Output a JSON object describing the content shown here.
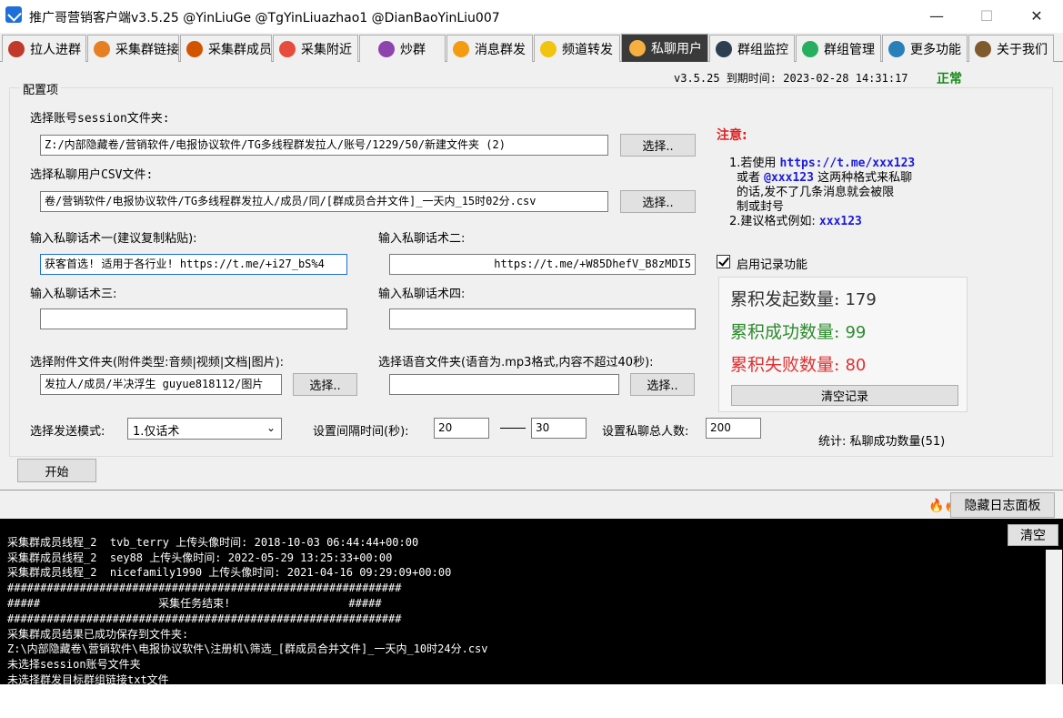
{
  "window": {
    "title": "推广哥营销客户端v3.5.25 @YinLiuGe @TgYinLiuazhao1 @DianBaoYinLiu007",
    "minimize": "—",
    "maximize": "☐",
    "close": "✕"
  },
  "tabs": [
    {
      "label": "拉人进群",
      "icon_color": "#c0392b"
    },
    {
      "label": "采集群链接",
      "icon_color": "#e67e22"
    },
    {
      "label": "采集群成员",
      "icon_color": "#d35400"
    },
    {
      "label": "采集附近",
      "icon_color": "#e74c3c"
    },
    {
      "label": "炒群",
      "icon_color": "#8e44ad"
    },
    {
      "label": "消息群发",
      "icon_color": "#f39c12"
    },
    {
      "label": "频道转发",
      "icon_color": "#f1c40f"
    },
    {
      "label": "私聊用户",
      "icon_color": "#f5b041"
    },
    {
      "label": "群组监控",
      "icon_color": "#2c3e50"
    },
    {
      "label": "群组管理",
      "icon_color": "#27ae60"
    },
    {
      "label": "更多功能",
      "icon_color": "#2980b9"
    },
    {
      "label": "关于我们",
      "icon_color": "#7f5a2c"
    }
  ],
  "active_tab": "私聊用户",
  "status": {
    "version_expiry": "v3.5.25 到期时间: 2023-02-28 14:31:17",
    "state": "正常"
  },
  "config": {
    "legend": "配置项",
    "session_label": "选择账号session文件夹:",
    "session_value": "Z:/内部隐藏卷/营销软件/电报协议软件/TG多线程群发拉人/账号/1229/50/新建文件夹 (2)",
    "choose_btn": "选择..",
    "csv_label": "选择私聊用户CSV文件:",
    "csv_value": "卷/营销软件/电报协议软件/TG多线程群发拉人/成员/同/[群成员合并文件]_一天内_15时02分.csv",
    "script1_label": "输入私聊话术一(建议复制粘贴):",
    "script1_value": "获客首选! 适用于各行业!  https://t.me/+i27_bS%4",
    "script2_label": "输入私聊话术二:",
    "script2_value": "https://t.me/+W85DhefV_B8zMDI5",
    "script3_label": "输入私聊话术三:",
    "script3_value": "",
    "script4_label": "输入私聊话术四:",
    "script4_value": "",
    "attach_label": "选择附件文件夹(附件类型:音频|视频|文档|图片):",
    "attach_value": "发拉人/成员/半决浮生 guyue818112/图片",
    "voice_label": "选择语音文件夹(语音为.mp3格式,内容不超过40秒):",
    "voice_value": "",
    "mode_label": "选择发送模式:",
    "mode_value": "1.仅话术",
    "interval_label": "设置间隔时间(秒):",
    "interval_min": "20",
    "interval_max": "30",
    "total_label": "设置私聊总人数:",
    "total_value": "200"
  },
  "notice": {
    "title": "注意:",
    "line1_prefix": "1.若使用 ",
    "line1_link": "https://t.me/xxx123",
    "line2_prefix": "或者 ",
    "line2_link": "@xxx123",
    "line2_suffix": " 这两种格式来私聊",
    "line3": "的话,发不了几条消息就会被限",
    "line4": "制或封号",
    "line5_prefix": "2.建议格式例如: ",
    "line5_link": "xxx123"
  },
  "record": {
    "checkbox_label": "启用记录功能",
    "checked": true,
    "total_label": "累积发起数量:",
    "total_value": "179",
    "success_label": "累积成功数量:",
    "success_value": "99",
    "fail_label": "累积失败数量:",
    "fail_value": "80",
    "clear_btn": "清空记录",
    "summary": "统计: 私聊成功数量(51)"
  },
  "actions": {
    "start_btn": "开始",
    "hide_log_btn": "隐藏日志面板",
    "clear_log_btn": "清空"
  },
  "log": [
    "采集群成员线程_2  tvb_terry 上传头像时间: 2018-10-03 06:44:44+00:00",
    "采集群成员线程_2  sey88 上传头像时间: 2022-05-29 13:25:33+00:00",
    "采集群成员线程_2  nicefamily1990 上传头像时间: 2021-04-16 09:29:09+00:00",
    "############################################################",
    "#####                  采集任务结束!                  #####",
    "############################################################",
    "采集群成员结果已成功保存到文件夹:",
    "Z:\\内部隐藏卷\\营销软件\\电报协议软件\\注册机\\筛选_[群成员合并文件]_一天内_10时24分.csv",
    "未选择session账号文件夹",
    "未选择群发目标群组链接txt文件"
  ],
  "colors": {
    "total": "#333333",
    "success": "#2e8b2e",
    "fail": "#e03030",
    "ok": "#1a8a1a"
  }
}
